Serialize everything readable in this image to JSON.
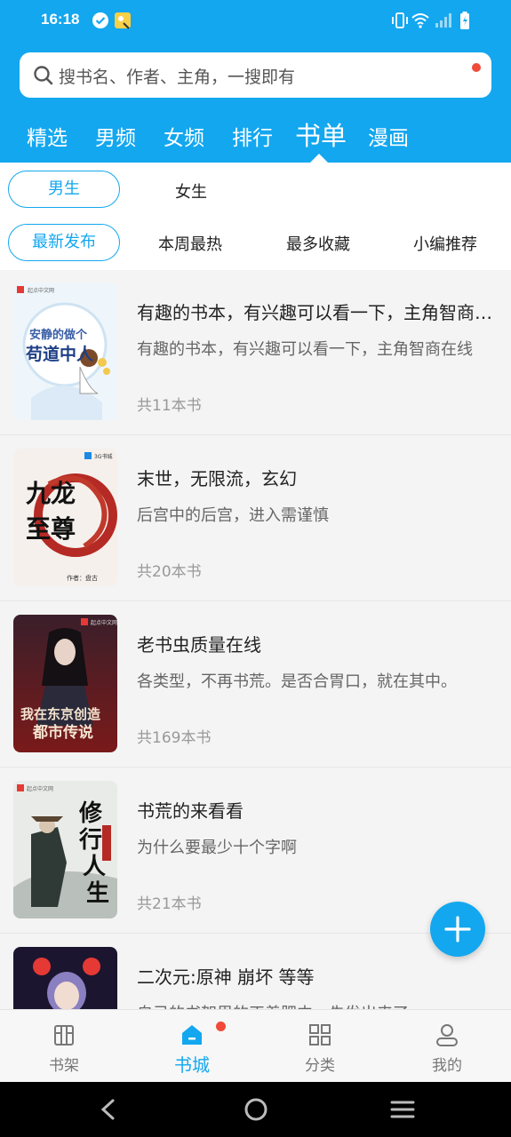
{
  "status": {
    "time": "16:18"
  },
  "search": {
    "placeholder": "搜书名、作者、主角，一搜即有"
  },
  "tabs": [
    {
      "label": "精选"
    },
    {
      "label": "男频"
    },
    {
      "label": "女频"
    },
    {
      "label": "排行"
    },
    {
      "label": "书单"
    },
    {
      "label": "漫画"
    }
  ],
  "active_tab": "书单",
  "gender_filters": [
    {
      "label": "男生"
    },
    {
      "label": "女生"
    }
  ],
  "sort_filters": [
    {
      "label": "最新发布"
    },
    {
      "label": "本周最热"
    },
    {
      "label": "最多收藏"
    },
    {
      "label": "小编推荐"
    }
  ],
  "booklists": [
    {
      "title": "有趣的书本，有兴趣可以看一下，主角智商在线",
      "desc": "有趣的书本，有兴趣可以看一下，主角智商在线",
      "count": "共11本书",
      "cover_text": "安静的做个苟道中人"
    },
    {
      "title": "末世，无限流，玄幻",
      "desc": "后宫中的后宫，进入需谨慎",
      "count": "共20本书",
      "cover_text": "九龙至尊"
    },
    {
      "title": "老书虫质量在线",
      "desc": "各类型，不再书荒。是否合胃口，就在其中。",
      "count": "共169本书",
      "cover_text": "我在东京创造都市传说"
    },
    {
      "title": "书荒的来看看",
      "desc": "为什么要最少十个字啊",
      "count": "共21本书",
      "cover_text": "修行人生"
    },
    {
      "title": "二次元:原神 崩坏 等等",
      "desc": "自己的书架里的正着肥中，先发出来了",
      "count": "",
      "cover_text": ""
    }
  ],
  "bottom_nav": [
    {
      "label": "书架",
      "icon": "bookshelf-icon"
    },
    {
      "label": "书城",
      "icon": "store-icon"
    },
    {
      "label": "分类",
      "icon": "category-icon"
    },
    {
      "label": "我的",
      "icon": "profile-icon"
    }
  ],
  "colors": {
    "accent": "#13a7ef",
    "badge": "#f04a3a"
  }
}
